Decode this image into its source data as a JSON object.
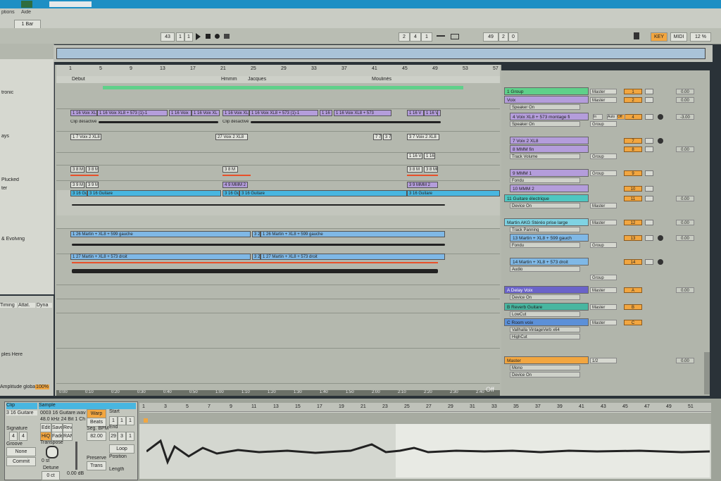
{
  "menu": {
    "items": [
      "ptions",
      "Aide"
    ],
    "zoom": "1 Bar"
  },
  "transport": {
    "tempo": "43",
    "sig_a": "1",
    "sig_b": "1",
    "pos_a": "2",
    "pos_b": "4",
    "pos_c": "1",
    "loop_a": "49",
    "loop_b": "2",
    "loop_c": "0",
    "key_label": "KEY",
    "midi_label": "MIDI",
    "cpu": "12 %"
  },
  "browser": {
    "items": [
      "tronic",
      "ays",
      "Plucked",
      "ter",
      "& Evolving"
    ],
    "tabs": [
      "Timing",
      "Attat.",
      "Dyna"
    ],
    "drop_hint": "ples Here",
    "global_amp_label": "Amplitude globale",
    "global_amp_value": "100%"
  },
  "ruler": {
    "bars": [
      "1",
      "5",
      "9",
      "13",
      "17",
      "21",
      "25",
      "29",
      "33",
      "37",
      "41",
      "45",
      "49",
      "53",
      "57"
    ],
    "locators": [
      "Début",
      "Hmmm",
      "Jacques",
      "Moulinés"
    ],
    "times": [
      "0:00",
      "0:10",
      "0:20",
      "0:30",
      "0:40",
      "0:50",
      "1:00",
      "1:10",
      "1:20",
      "1:30",
      "1:40",
      "1:50",
      "2:00",
      "2:10",
      "2:20",
      "2:30",
      "2:40"
    ],
    "off_label": "Off"
  },
  "clips": {
    "voix1": [
      "1 16 Voix XL",
      "1 16 Voix XL8 + 573 (1)-1",
      "1 16 Voix",
      "1 16 Voix XL",
      "1 16 Voix XL",
      "1 16 Voix XL8 + 573 (1)-1",
      "1 16",
      "1 16 Voix XL8 + 573"
    ],
    "voix1_short": [
      "1 16 V",
      "1 16 V",
      "1 16 V"
    ],
    "clip_off": "Clip désactivé",
    "voix2": [
      "1 7 Voix 2 XL8",
      "27 Voix 2 XL8",
      "7 7",
      "3 7",
      "3 7 Voix 2 XL8"
    ],
    "mmm1": [
      "3 8 M",
      "3 8 M",
      "3 8 M",
      "3 8 M",
      "3 8 MM"
    ],
    "mmm2": [
      "3 9 M",
      "3 9 M",
      "4 9 MMM 2",
      "3 9 MMM 2"
    ],
    "guitare": [
      "3 16 Gu",
      "3 16 Guitare",
      "3 16 Gu",
      "3 16 Guitare",
      "3 16 Guitare"
    ],
    "martin_g": [
      "1 26 Martin + XL8 + 599 gauche",
      "1 26 Martin + XL8 + 599 gauche"
    ],
    "martin_d": [
      "1 27 Martin + XL8 + 573 droit",
      "1 27 Martin + XL8 + 573 droit"
    ],
    "martin_g_small": "3 2",
    "martin_d_small": "3 2"
  },
  "mixer": {
    "tracks": [
      {
        "name": "1 Group",
        "color": "#5fd08a",
        "io": "Master",
        "num": "1"
      },
      {
        "name": "Voix",
        "color": "#b49ddb",
        "io": "Master",
        "num": "2"
      },
      {
        "name": "4 Voix XL8 + 573  montage fi",
        "color": "#b49ddb",
        "io": "Group",
        "num": "4"
      },
      {
        "name": "7 Voix 2 XL8",
        "color": "#b49ddb",
        "io": "",
        "num": "7"
      },
      {
        "name": "8 MMM fin",
        "color": "#b49ddb",
        "io": "Group",
        "num": "8"
      },
      {
        "name": "9 MMM 1",
        "color": "#b49ddb",
        "io": "Group",
        "num": "9"
      },
      {
        "name": "10 MMM 2",
        "color": "#b49ddb",
        "io": "",
        "num": "10"
      },
      {
        "name": "11 Guitare électrique",
        "color": "#4ec7c1",
        "io": "Master",
        "num": "11"
      },
      {
        "name": "Martin AKG Stéréo prise large",
        "color": "#7fd3e3",
        "io": "Master",
        "num": "12"
      },
      {
        "name": "13 Martin + XL8 + 599 gauch",
        "color": "#7fb8e6",
        "io": "Group",
        "num": "13"
      },
      {
        "name": "14 Martin + XL8 + 573 droit",
        "color": "#7fb8e6",
        "io": "Group",
        "num": "14"
      },
      {
        "name": "A Delay Voix",
        "color": "#6a63c9",
        "io": "Master",
        "num": "A"
      },
      {
        "name": "B Reverb Guitare",
        "color": "#48b6a0",
        "io": "Master",
        "num": "B"
      },
      {
        "name": "C Room voix",
        "color": "#5c90d8",
        "io": "Master",
        "num": "C"
      },
      {
        "name": "Master",
        "color": "#f2a640",
        "io": "1/2",
        "num": ""
      }
    ],
    "subs": [
      "Speaker On",
      "Speaker On",
      "Track Volume",
      "Fondu",
      "Device On",
      "Track Panning",
      "Fondu",
      "Audio",
      "Device On",
      "LowCut",
      "Vallhalla VintageVerb x64",
      "HighCut",
      "Mono",
      "Device On"
    ],
    "vol_values": [
      "0.00",
      "0.00",
      "-3.00",
      "0.00",
      "0.00",
      "0.00",
      "0.00",
      "0.00",
      "0.00"
    ],
    "auto_label": "Auto",
    "in_label": "In",
    "off_label": "Off"
  },
  "detail": {
    "clip_tab": "Clip",
    "sample_tab": "Sample",
    "clip_name": "3 16 Guitare",
    "file_name": "0003 16 Guitare.wav",
    "file_info": "48.0 kHz 24 Bit 1 Ch",
    "signature_label": "Signature",
    "sig_values": [
      "4",
      "4"
    ],
    "groove_label": "Groove",
    "groove_value": "None",
    "commit_label": "Commit",
    "edit_label": "Edit",
    "save_label": "Save",
    "rev_label": "Rev.",
    "hiq_label": "HiQ",
    "fade_label": "Fade",
    "ram_label": "RAM",
    "transpose_label": "Transpose",
    "transpose_value": "0 st",
    "detune_label": "Detune",
    "detune_value": "0 ct",
    "gain_value": "0.00 dB",
    "warp_label": "Warp",
    "beats_label": "Beats",
    "seg_bpm_label": "Seg. BPM",
    "seg_bpm_value": "82.00",
    "preserve_label": "Preserve",
    "preserve_value": "Trans",
    "start_label": "Start",
    "start_vals": [
      "1",
      "1",
      "1"
    ],
    "end_label": "End",
    "end_vals": [
      "29",
      "3",
      "1"
    ],
    "loop_label": "Loop",
    "position_label": "Position",
    "length_label": "Length",
    "sample_bars": [
      "1",
      "3",
      "5",
      "7",
      "9",
      "11",
      "13",
      "15",
      "17",
      "19",
      "21",
      "23",
      "25",
      "27",
      "29",
      "31",
      "33",
      "35",
      "37",
      "39",
      "41",
      "43",
      "45",
      "47",
      "49",
      "51"
    ]
  }
}
